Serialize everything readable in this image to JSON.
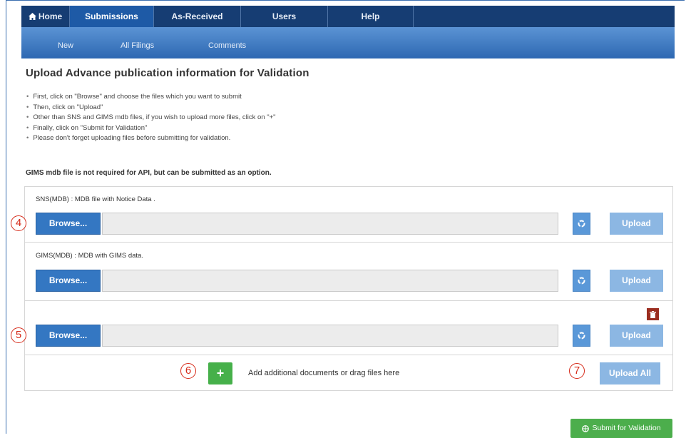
{
  "topnav": {
    "items": [
      {
        "label": "Home",
        "icon": "home-icon"
      },
      {
        "label": "Submissions"
      },
      {
        "label": "As-Received"
      },
      {
        "label": "Users"
      },
      {
        "label": "Help"
      }
    ],
    "active": "Submissions"
  },
  "subnav": {
    "items": [
      "New",
      "All Filings",
      "Comments"
    ]
  },
  "page": {
    "title": "Upload Advance publication information for Validation",
    "instructions": [
      "First, click on \"Browse\" and choose the files which you want to submit",
      "Then, click on \"Upload\"",
      "Other than SNS and GIMS mdb files, if you wish to upload more files, click on \"+\"",
      "Finally, click on \"Submit for Validation\"",
      "Please don't forget uploading files before submitting for validation."
    ],
    "note": "GIMS mdb file is not required for API, but can be submitted as an option."
  },
  "uploads": [
    {
      "label": "SNS(MDB) : MDB file with Notice Data .",
      "browse": "Browse...",
      "upload": "Upload",
      "marker": "4"
    },
    {
      "label": "GIMS(MDB) : MDB with GIMS data.",
      "browse": "Browse...",
      "upload": "Upload"
    },
    {
      "label": "",
      "browse": "Browse...",
      "upload": "Upload",
      "marker": "5"
    }
  ],
  "add": {
    "plus": "+",
    "text": "Add additional documents or drag files here",
    "marker": "6"
  },
  "upload_all": {
    "label": "Upload All",
    "marker": "7"
  },
  "submit": {
    "label": "Submit for Validation",
    "icon": "globe-icon"
  },
  "colors": {
    "nav_dark": "#163d73",
    "nav_active": "#1e5aa6",
    "browse_blue": "#3477c2",
    "upload_light": "#8cb7e3",
    "green": "#46b04a",
    "marker_red": "#d62b1a",
    "trash_red": "#9b2d1f"
  }
}
